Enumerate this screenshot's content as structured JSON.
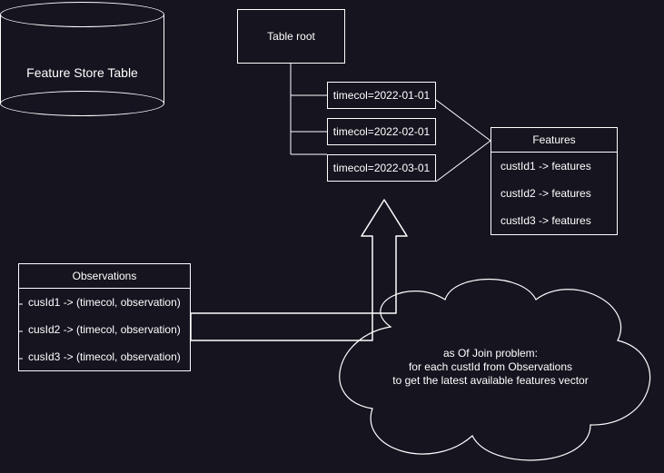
{
  "cylinder": {
    "label": "Feature Store Table"
  },
  "root": {
    "label": "Table root"
  },
  "partitions": {
    "p1": "timecol=2022-01-01",
    "p2": "timecol=2022-02-01",
    "p3": "timecol=2022-03-01"
  },
  "features": {
    "title": "Features",
    "r1": "custId1 -> features",
    "r2": "custId2 -> features",
    "r3": "custId3 -> features"
  },
  "observations": {
    "title": "Observations",
    "r1": "cusId1 -> (timecol, observation)",
    "r2": "cusId2 -> (timecol, observation)",
    "r3": "cusId3 -> (timecol, observation)"
  },
  "cloud": {
    "l1": "as Of Join problem:",
    "l2": "for each custId from Observations",
    "l3": "to get the latest available features vector"
  }
}
